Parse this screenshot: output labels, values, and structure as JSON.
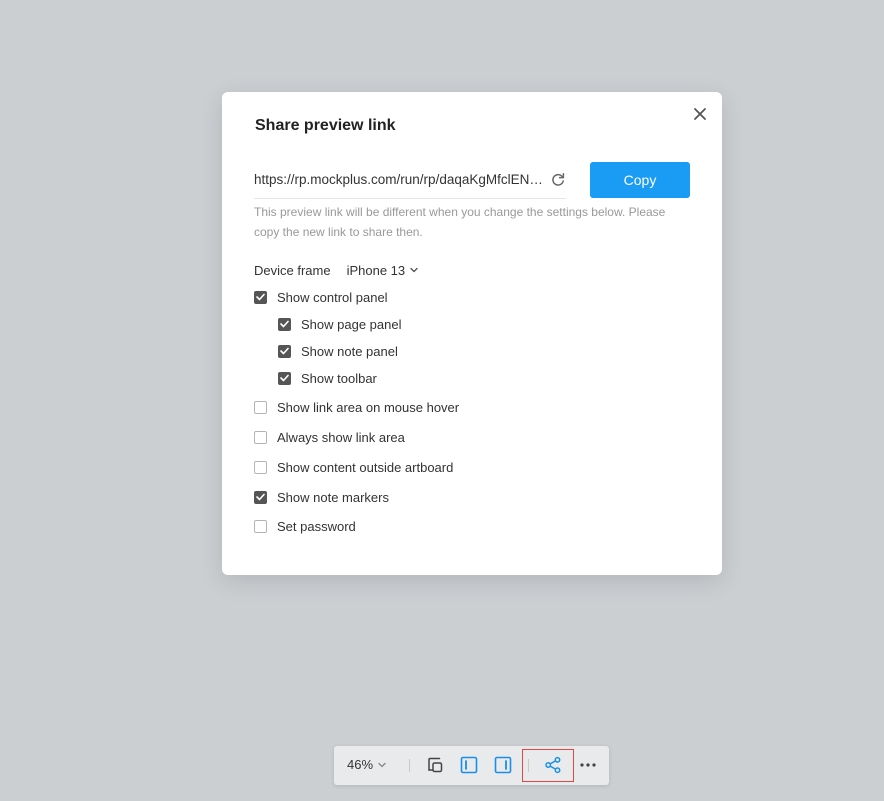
{
  "dialog": {
    "title": "Share preview link",
    "link_url": "https://rp.mockplus.com/run/rp/daqaKgMfclENZ/...",
    "copy_label": "Copy",
    "hint": "This preview link will be different when you change the settings below. Please copy the new link to share then.",
    "device_frame_label": "Device frame",
    "device_frame_value": "iPhone 13",
    "options": [
      {
        "label": "Show control panel",
        "checked": true
      },
      {
        "label": "Show page panel",
        "checked": true
      },
      {
        "label": "Show note panel",
        "checked": true
      },
      {
        "label": "Show toolbar",
        "checked": true
      },
      {
        "label": "Show link area on mouse hover",
        "checked": false
      },
      {
        "label": "Always show link area",
        "checked": false
      },
      {
        "label": "Show content outside artboard",
        "checked": false
      },
      {
        "label": "Show note markers",
        "checked": true
      },
      {
        "label": "Set password",
        "checked": false
      }
    ]
  },
  "toolbar": {
    "zoom_label": "46%",
    "icons": [
      "frame-icon",
      "left-panel-icon",
      "right-panel-icon",
      "share-icon",
      "more-icon"
    ]
  },
  "colors": {
    "accent": "#1a9cf5",
    "background": "#cbcfd2",
    "checkbox_checked": "#555555",
    "highlight": "#e04848"
  }
}
